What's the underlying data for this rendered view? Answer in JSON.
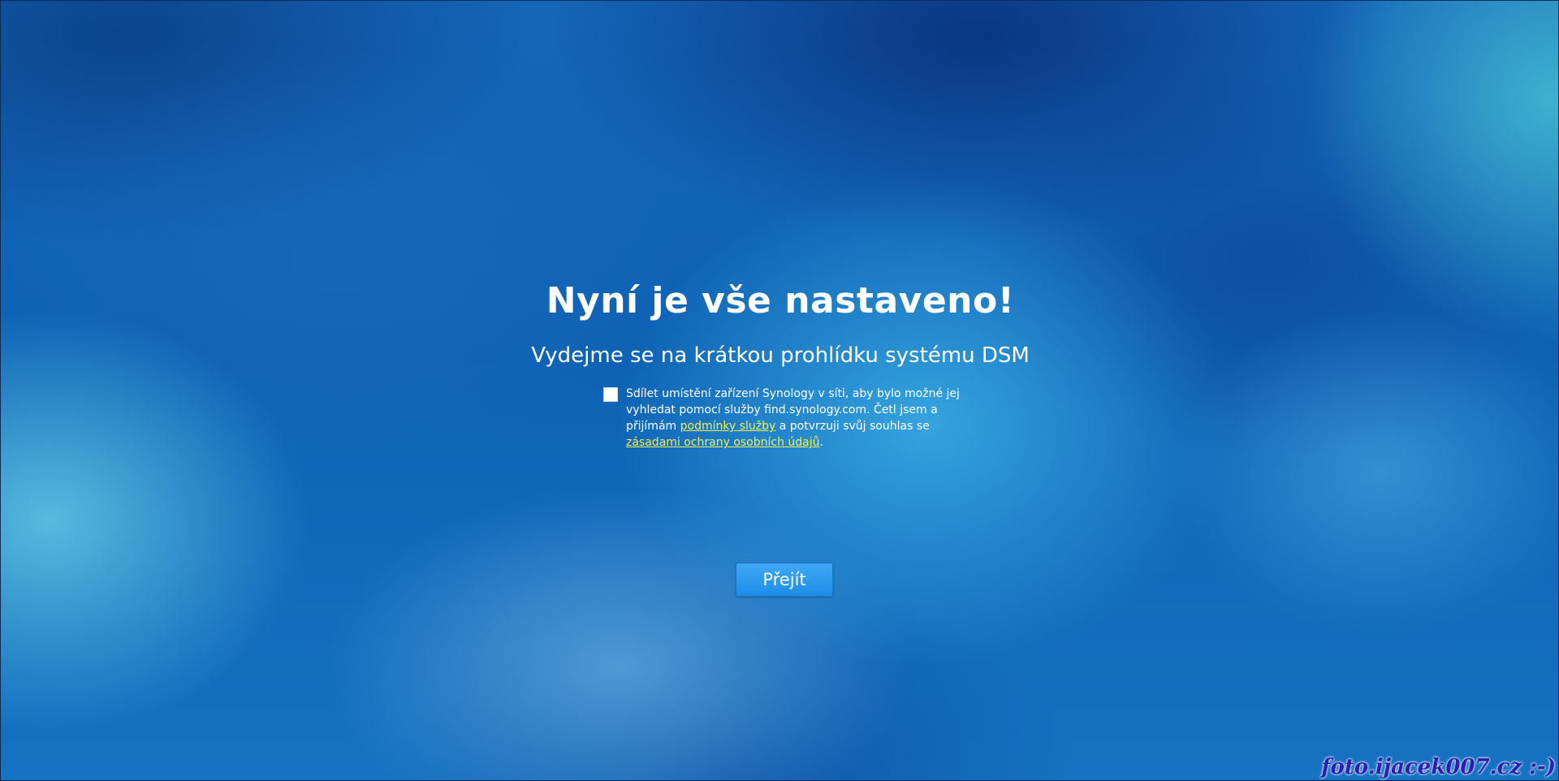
{
  "heading": {
    "title": "Nyní je vše nastaveno!",
    "subtitle": "Vydejme se na krátkou prohlídku systému DSM"
  },
  "consent": {
    "checked": false,
    "text_part1": "Sdílet umístění zařízení Synology v síti, aby bylo možné jej vyhledat pomocí služby find.synology.com. Četl jsem a přijímám ",
    "terms_link": "podmínky služby",
    "text_part2": " a potvrzuji svůj souhlas se ",
    "privacy_link": "zásadami ochrany osobních údajů",
    "text_part3": "."
  },
  "actions": {
    "go_label": "Přejít"
  },
  "watermark": "foto.ijacek007.cz :-)",
  "colors": {
    "link": "#f2ef5a",
    "button": "#2a96ec",
    "background": "#0e62b4",
    "watermark": "#2a1fb0"
  }
}
